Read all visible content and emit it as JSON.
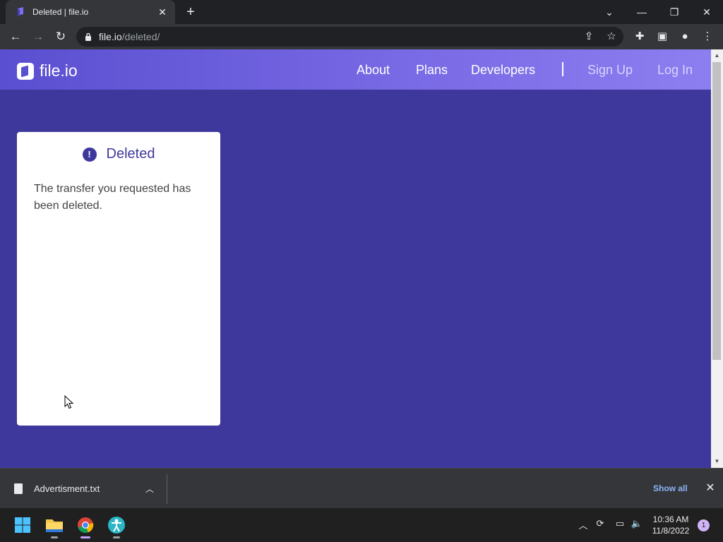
{
  "browser": {
    "tab_title": "Deleted | file.io",
    "tab_close": "✕",
    "new_tab": "+",
    "url_host": "file.io",
    "url_path": "/deleted/"
  },
  "site": {
    "logo_text": "file.io",
    "nav": {
      "about": "About",
      "plans": "Plans",
      "developers": "Developers",
      "signup": "Sign Up",
      "login": "Log In"
    }
  },
  "card": {
    "title": "Deleted",
    "icon_glyph": "!",
    "message": "The transfer you requested has been deleted."
  },
  "downloads": {
    "filename": "Advertisment.txt",
    "show_all": "Show all"
  },
  "taskbar": {
    "time": "10:36 AM",
    "date": "11/8/2022",
    "notifications": "1"
  },
  "colors": {
    "page_bg": "#3f389c",
    "header_gradient_start": "#5a4fd0",
    "header_gradient_end": "#8d7ef0",
    "accent": "#3f389c",
    "link_blue": "#8ab4f8"
  }
}
